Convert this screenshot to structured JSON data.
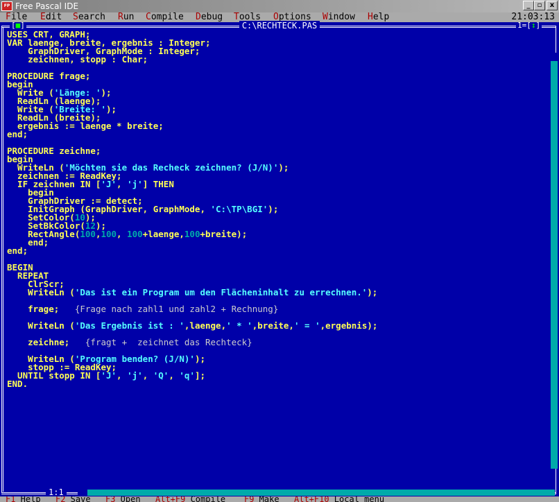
{
  "window": {
    "title": "Free Pascal IDE",
    "minimize": "_",
    "maximize": "▫",
    "close": "x"
  },
  "menu": {
    "items": [
      {
        "hot": "F",
        "rest": "ile"
      },
      {
        "hot": "E",
        "rest": "dit"
      },
      {
        "hot": "S",
        "rest": "earch"
      },
      {
        "hot": "R",
        "rest": "un"
      },
      {
        "hot": "C",
        "rest": "ompile"
      },
      {
        "hot": "D",
        "rest": "ebug"
      },
      {
        "hot": "T",
        "rest": "ools"
      },
      {
        "hot": "O",
        "rest": "ptions"
      },
      {
        "hot": "W",
        "rest": "indow"
      },
      {
        "hot": "H",
        "rest": "elp"
      }
    ],
    "clock": "21:03:13"
  },
  "editor": {
    "file_title": "C:\\RECHTECK.PAS",
    "window_number": "1",
    "cursor_position": "1:1",
    "close_box": {
      "left": "[",
      "mark": "■",
      "right": "]"
    },
    "zoom_box": {
      "left": "[",
      "mark": "↕",
      "right": "]"
    },
    "code_lines": [
      "USES CRT, GRAPH;",
      "VAR laenge, breite, ergebnis : Integer;",
      "    GraphDriver, GraphMode : Integer;",
      "    zeichnen, stopp : Char;",
      "",
      "PROCEDURE frage;",
      "begin",
      "  Write ('Länge: ');",
      "  ReadLn (laenge);",
      "  Write ('Breite: ');",
      "  ReadLn (breite);",
      "  ergebnis := laenge * breite;",
      "end;",
      "",
      "PROCEDURE zeichne;",
      "begin",
      "  WriteLn ('Möchten sie das Recheck zeichnen? (J/N)');",
      "  zeichnen := ReadKey;",
      "  IF zeichnen IN ['J', 'j'] THEN",
      "    begin",
      "    GraphDriver := detect;",
      "    InitGraph (GraphDriver, GraphMode, 'C:\\TP\\BGI');",
      "    SetColor(10);",
      "    SetBkColor(12);",
      "    RectAngle(100,100, 100+laenge,100+breite);",
      "    end;",
      "end;",
      "",
      "BEGIN",
      "  REPEAT",
      "    ClrScr;",
      "    WriteLn ('Das ist ein Program um den Flächeninhalt zu errechnen.');",
      "",
      "    frage;   {Frage nach zahl1 und zahl2 + Rechnung}",
      "",
      "    WriteLn ('Das Ergebnis ist : ',laenge,' * ',breite,' = ',ergebnis);",
      "",
      "    zeichne;   {fragt +  zeichnet das Rechteck}",
      "",
      "    WriteLn ('Program benden? (J/N)');",
      "    stopp := ReadKey;",
      "  UNTIL stopp IN ['J', 'j', 'Q', 'q'];",
      "END."
    ]
  },
  "status": {
    "items": [
      {
        "key": "F1",
        "label": " Help"
      },
      {
        "key": "F2",
        "label": " Save"
      },
      {
        "key": "F3",
        "label": " Open"
      },
      {
        "key": "Alt+F9",
        "label": " Compile"
      },
      {
        "key": "F9",
        "label": " Make"
      },
      {
        "key": "Alt+F10",
        "label": " Local menu"
      }
    ]
  },
  "colors": {
    "editor_bg": "#0000a8",
    "code_text": "#ffff55",
    "string_text": "#55ffff",
    "number_text": "#00aaaa",
    "menu_bg": "#aaaaaa",
    "hotkey": "#aa0000"
  }
}
